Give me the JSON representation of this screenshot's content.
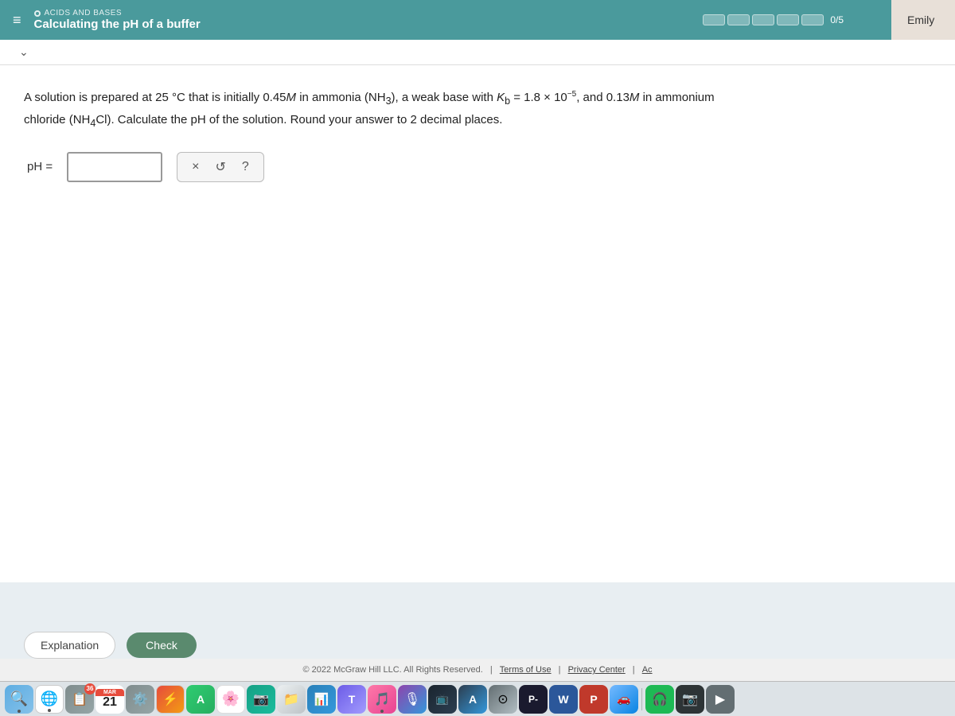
{
  "header": {
    "menu_icon": "≡",
    "category": "ACIDS AND BASES",
    "title": "Calculating the pH of a buffer",
    "progress": {
      "label": "0/5",
      "segments": 5
    }
  },
  "user": {
    "name": "Emily"
  },
  "problem": {
    "text_part1": "A solution is prepared at 25 °C that is initially 0.45",
    "M1": "M",
    "text_part2": " in ammonia (NH",
    "nh3_sub": "3",
    "text_part3": "), a weak base with K",
    "kb_sub": "b",
    "text_part4": "= 1.8 × 10",
    "exp": "−5",
    "text_part5": ", and 0.13",
    "M2": "M",
    "text_part6": " in ammonium chloride (NH",
    "nh4_sub": "4",
    "text_part7": "Cl). Calculate the pH of the solution. Round your answer to 2 decimal places.",
    "full_text": "A solution is prepared at 25 °C that is initially 0.45M in ammonia (NH₃), a weak base with Kᵦ = 1.8 × 10⁻⁵, and 0.13M in ammonium chloride (NH₄Cl). Calculate the pH of the solution. Round your answer to 2 decimal places."
  },
  "input": {
    "ph_label": "pH =",
    "ph_value": "",
    "ph_placeholder": ""
  },
  "buttons": {
    "clear": "×",
    "undo": "↺",
    "help": "?",
    "explanation": "Explanation",
    "check": "Check"
  },
  "footer": {
    "copyright": "© 2022 McGraw Hill LLC. All Rights Reserved.",
    "terms": "Terms of Use",
    "privacy": "Privacy Center",
    "accessibility": "Ac"
  },
  "dock": {
    "calendar_month": "MAR",
    "calendar_date": "21"
  }
}
